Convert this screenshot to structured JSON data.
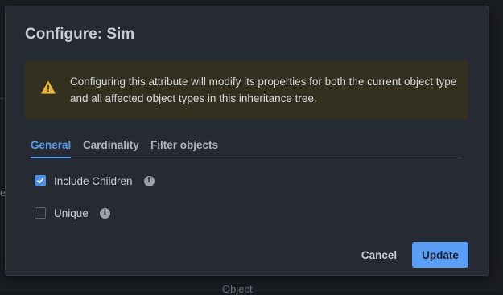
{
  "background": {
    "stray_char": "e",
    "partial_text": "Object"
  },
  "dialog": {
    "title": "Configure: Sim",
    "warning": {
      "icon": "warning-triangle-icon",
      "text": "Configuring this attribute will modify its properties for both the current object type and all affected object types in this inheritance tree."
    },
    "tabs": [
      {
        "label": "General",
        "active": true
      },
      {
        "label": "Cardinality",
        "active": false
      },
      {
        "label": "Filter objects",
        "active": false
      }
    ],
    "options": [
      {
        "label": "Include Children",
        "checked": true,
        "info_icon": "i"
      },
      {
        "label": "Unique",
        "checked": false,
        "info_icon": "i"
      }
    ],
    "buttons": {
      "cancel": "Cancel",
      "update": "Update"
    }
  },
  "colors": {
    "accent": "#5b9ef5",
    "warning_bg": "#34301f",
    "warning_icon": "#e8b530",
    "dialog_bg": "#262a32"
  }
}
